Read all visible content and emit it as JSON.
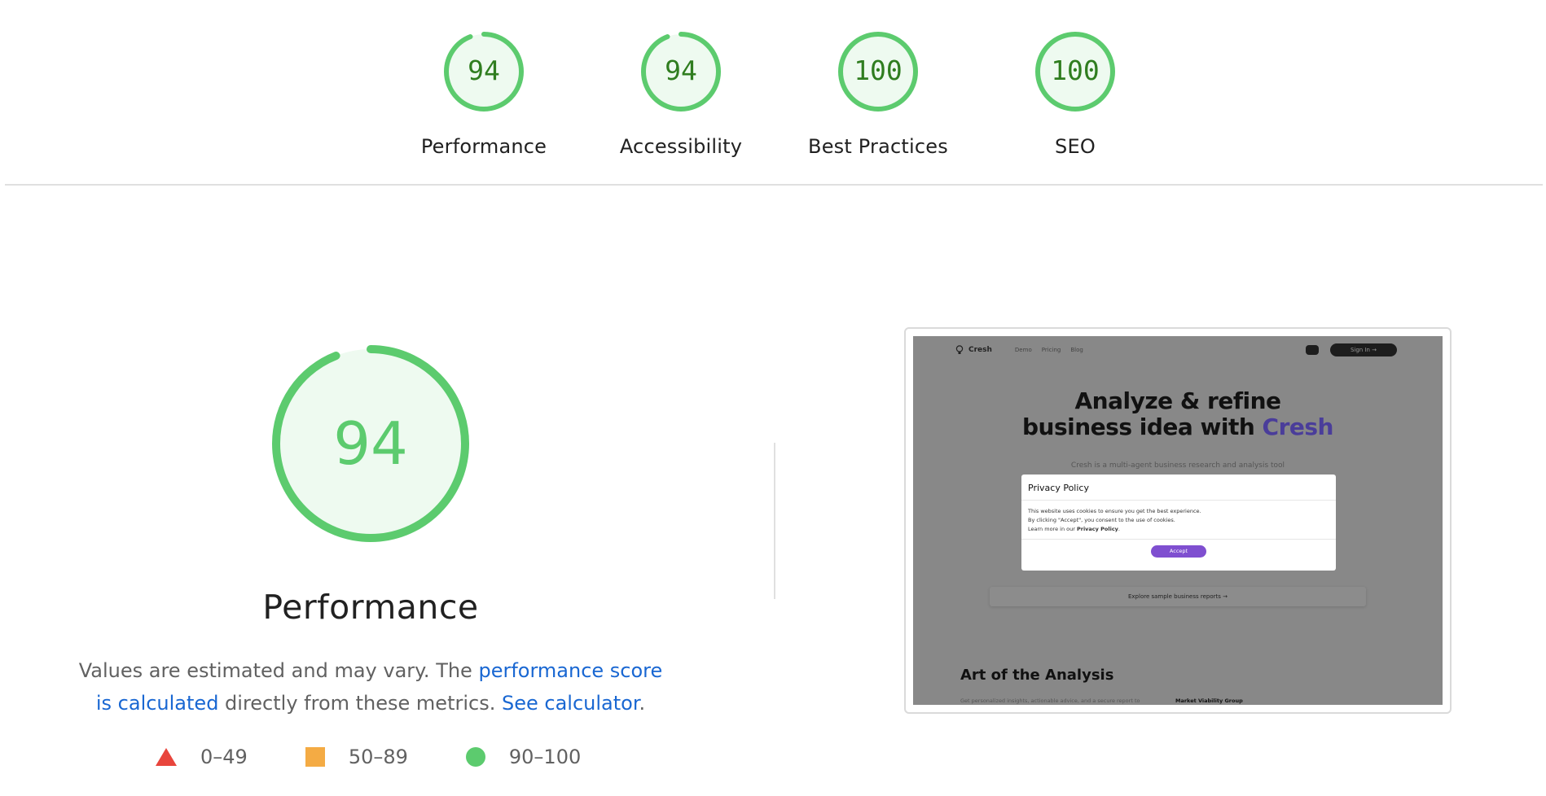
{
  "categories": [
    {
      "score": "94",
      "value": 94,
      "label": "Performance"
    },
    {
      "score": "94",
      "value": 94,
      "label": "Accessibility"
    },
    {
      "score": "100",
      "value": 100,
      "label": "Best Practices"
    },
    {
      "score": "100",
      "value": 100,
      "label": "SEO"
    }
  ],
  "performance": {
    "score": "94",
    "value": 94,
    "title": "Performance",
    "desc_prefix": "Values are estimated and may vary. The ",
    "desc_link1": "performance score is calculated",
    "desc_middle": " directly from these metrics. ",
    "desc_link2": "See calculator",
    "desc_suffix": "."
  },
  "legend": [
    {
      "shape": "triangle",
      "color": "#e8453c",
      "range": "0–49"
    },
    {
      "shape": "square",
      "color": "#f4ab44",
      "range": "50–89"
    },
    {
      "shape": "circle",
      "color": "#5ccb6e",
      "range": "90–100"
    }
  ],
  "colors": {
    "pass": "#5ccb6e",
    "pass_bg": "#eefaf0",
    "pass_text_small": "#2f7d1f",
    "pass_text_large": "#5ccb6e",
    "link": "#1967d2"
  },
  "thumbnail": {
    "brand": "Cresh",
    "nav_links": [
      "Demo",
      "Pricing",
      "Blog"
    ],
    "signin": "Sign In →",
    "hero_line1": "Analyze & refine",
    "hero_line2": "business idea with ",
    "hero_brand": "Cresh",
    "subtitle": "Cresh is a multi-agent business research and analysis tool",
    "modal_title": "Privacy Policy",
    "modal_line1": "This website uses cookies to ensure you get the best experience.",
    "modal_line2": "By clicking \"Accept\", you consent to the use of cookies.",
    "modal_line3": "Learn more in our ",
    "modal_link": "Privacy Policy",
    "accept": "Accept",
    "explore": "Explore sample business reports →",
    "art_title": "Art of the Analysis",
    "art_sub": "Get personalized insights, actionable advice, and a secure report to",
    "art_tag": "Market Viability Group"
  }
}
